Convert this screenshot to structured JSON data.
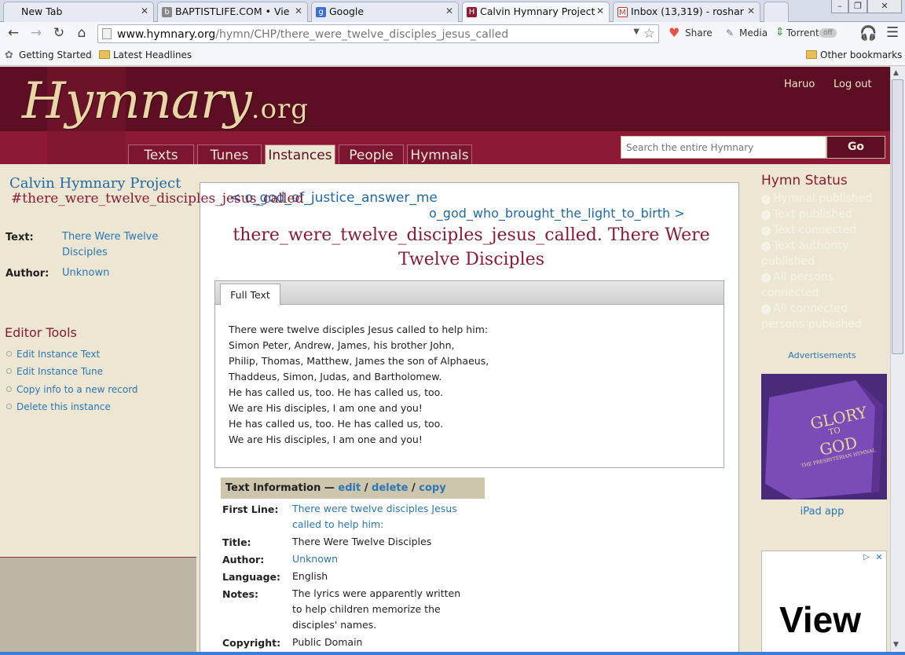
{
  "browser": {
    "tabs": [
      {
        "label": "New Tab",
        "icon": "blank-page-icon",
        "active": false
      },
      {
        "label": "BAPTISTLIFE.COM • Vie",
        "icon": "baptistlife-icon",
        "active": false
      },
      {
        "label": "Google",
        "icon": "google-icon",
        "active": false
      },
      {
        "label": "Calvin Hymnary Project",
        "icon": "hymnary-icon",
        "active": true
      },
      {
        "label": "Inbox (13,319) - roshar",
        "icon": "gmail-icon",
        "active": false
      }
    ],
    "url_domain": "www.hymnary.org",
    "url_path": "/hymn/CHP/there_were_twelve_disciples_jesus_called",
    "toolbar": {
      "share": "Share",
      "media": "Media",
      "torrent": "Torrent",
      "torrent_state": "off"
    },
    "bookmarks": {
      "getting_started": "Getting Started",
      "latest_headlines": "Latest Headlines",
      "other": "Other bookmarks"
    }
  },
  "site": {
    "logo_main": "Hymnary",
    "logo_suffix": ".org",
    "user_name": "Haruo",
    "logout": "Log out",
    "nav": [
      {
        "label": "Texts",
        "active": false
      },
      {
        "label": "Tunes",
        "active": false
      },
      {
        "label": "Instances",
        "active": true
      },
      {
        "label": "People",
        "active": false
      },
      {
        "label": "Hymnals",
        "active": false
      }
    ],
    "search_placeholder": "Search the entire Hymnary",
    "search_button": "Go"
  },
  "left": {
    "hymnal_title": "Calvin Hymnary Project",
    "slug": "#there_were_twelve_disciples_jesus_called",
    "text_label": "Text:",
    "text_value": "There Were Twelve Disciples",
    "author_label": "Author:",
    "author_value": "Unknown",
    "editor_tools_title": "Editor Tools",
    "editor_tools": [
      "Edit Instance Text",
      "Edit Instance Tune",
      "Copy info to a new record",
      "Delete this instance"
    ]
  },
  "main": {
    "prev_link": "< o_god_of_justice_answer_me",
    "next_link": "o_god_who_brought_the_light_to_birth >",
    "title_line1": "there_were_twelve_disciples_jesus_called. There Were",
    "title_line2": "Twelve Disciples",
    "full_text_tab": "Full Text",
    "lyrics": [
      "There were twelve disciples Jesus called to help him:",
      "Simon Peter, Andrew, James, his brother John,",
      "Philip, Thomas, Matthew, James the son of Alphaeus,",
      "Thaddeus, Simon, Judas, and Bartholomew.",
      "He has called us, too. He has called us, too.",
      "We are His disciples, I am one and you!",
      "He has called us, too. He has called us, too.",
      "We are His disciples, I am one and you!"
    ],
    "info_head": "Text Information —",
    "info_edit": "edit",
    "info_delete": "delete",
    "info_copy": "copy",
    "info_sep": "/",
    "info": {
      "first_line_label": "First Line:",
      "first_line": "There were twelve disciples Jesus called to help him:",
      "title_label": "Title:",
      "title": "There Were Twelve Disciples",
      "author_label": "Author:",
      "author": "Unknown",
      "language_label": "Language:",
      "language": "English",
      "notes_label": "Notes:",
      "notes": "The lyrics were apparently written to help children memorize the disciples' names.",
      "copyright_label": "Copyright:",
      "copyright": "Public Domain"
    }
  },
  "right": {
    "status_title": "Hymn Status",
    "status_items": [
      "Hymnal published",
      "Text published",
      "Text connected",
      "Text authority published",
      "All persons connected",
      "All connected persons published"
    ],
    "ads_label": "Advertisements",
    "book_line1": "GLORY",
    "book_line2": "TO",
    "book_line3": "GOD",
    "book_line4": "THE PRESBYTERIAN HYMNAL",
    "ipad_link": "iPad app",
    "ad2_text": "View"
  },
  "colors": {
    "maroon": "#5c0f22",
    "crimson": "#8c1a35",
    "link": "#2b77b5",
    "tan": "#ece6d3"
  }
}
